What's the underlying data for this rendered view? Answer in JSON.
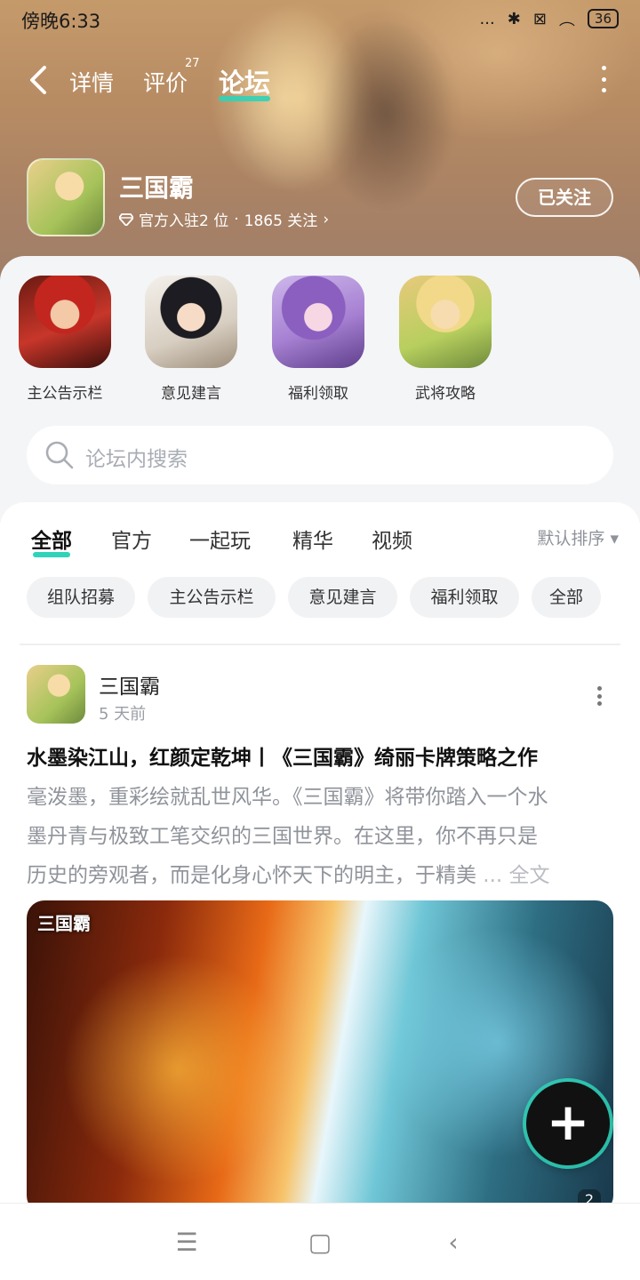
{
  "status_bar": {
    "time": "傍晚6:33",
    "signal": "...",
    "bluetooth": "✱",
    "sim": "⊠",
    "wifi": "︵",
    "battery": "36"
  },
  "nav": {
    "tabs": [
      {
        "label": "详情"
      },
      {
        "label": "评价",
        "badge": "27"
      },
      {
        "label": "论坛"
      }
    ],
    "active_tab": "论坛"
  },
  "game": {
    "name": "三国霸",
    "meta_rank": "官方入驻2 位",
    "meta_sep": "·",
    "meta_follow": "1865 关注",
    "meta_arrow": "›",
    "follow_button": "已关注"
  },
  "sections": [
    {
      "label": "主公告示栏"
    },
    {
      "label": "意见建言"
    },
    {
      "label": "福利领取"
    },
    {
      "label": "武将攻略"
    }
  ],
  "search": {
    "placeholder": "论坛内搜索"
  },
  "feed": {
    "tabs": [
      "全部",
      "官方",
      "一起玩",
      "精华",
      "视频"
    ],
    "sort_label": "默认排序 ▾",
    "chips": [
      "组队招募",
      "主公告示栏",
      "意见建言",
      "福利领取",
      "全部"
    ]
  },
  "post": {
    "author": "三国霸",
    "time": "5 天前",
    "title": "水墨染江山，红颜定乾坤丨《三国霸》绮丽卡牌策略之作",
    "body_line1": "毫泼墨，重彩绘就乱世风华。《三国霸》将带你踏入一个水",
    "body_line2": "墨丹青与极致工笔交织的三国世界。在这里，你不再只是",
    "body_line3": "历史的旁观者，而是化身心怀天下的明主，于精美",
    "body_more": " ... 全文",
    "image_logo": "三国霸",
    "image_count": "2"
  },
  "fab": {
    "label": "+"
  },
  "system_nav": {
    "menu": "☰",
    "home": "▢",
    "back": "‹"
  },
  "colors": {
    "accent": "#2fd3b8",
    "chip_bg": "#f1f2f4",
    "panel_bg": "#f4f5f7"
  }
}
